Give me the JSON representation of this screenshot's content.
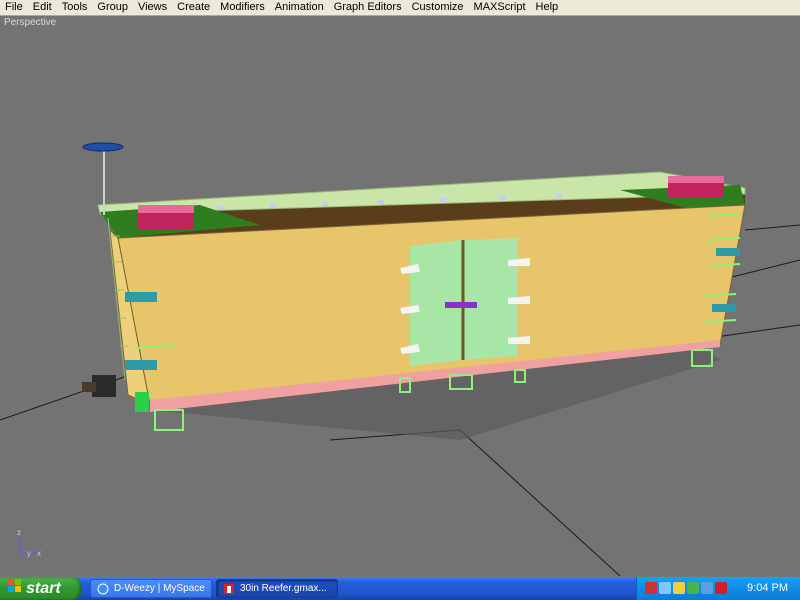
{
  "app": {
    "menu": [
      "File",
      "Edit",
      "Tools",
      "Group",
      "Views",
      "Create",
      "Modifiers",
      "Animation",
      "Graph Editors",
      "Customize",
      "MAXScript",
      "Help"
    ]
  },
  "viewport": {
    "label": "Perspective",
    "axis_labels": {
      "x": "x",
      "y": "y",
      "z": "z"
    }
  },
  "colors": {
    "viewport_bg": "#737373",
    "car_side": "#e8c56a",
    "car_end": "#efd07a",
    "roof": "#5a3e1c",
    "door": "#a8e6a8",
    "trim_green": "#8ff07a",
    "hatch": "#c0245a",
    "stripe_pink": "#f0a0a0",
    "teal_block": "#2f9aa8",
    "taskbar_blue": "#245edb",
    "start_green": "#3ca43c"
  },
  "taskbar": {
    "start_label": "start",
    "tasks": [
      {
        "label": "D-Weezy | MySpace",
        "icon": "browser-icon"
      },
      {
        "label": "30in Reefer.gmax...",
        "icon": "gmax-icon"
      }
    ],
    "tray_icons": [
      "security-icon",
      "network-icon",
      "volume-icon",
      "update-icon",
      "messenger-icon",
      "antivirus-icon"
    ],
    "clock": "9:04 PM"
  }
}
